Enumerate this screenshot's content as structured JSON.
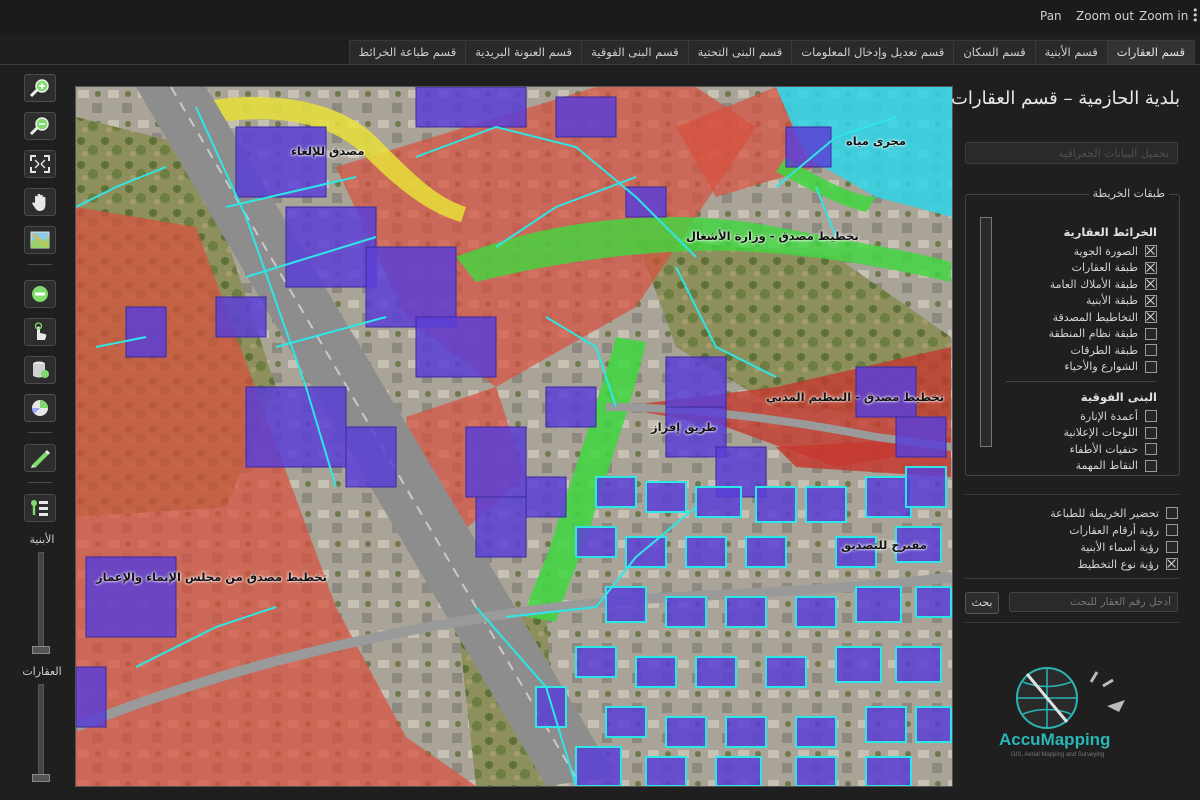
{
  "topbar": {
    "pan": "Pan",
    "zoom_out": "Zoom out",
    "zoom_in": "Zoom in"
  },
  "tabs": [
    "قسم العقارات",
    "قسم الأبنية",
    "قسم السكان",
    "قسم تعديل وإدخال المعلومات",
    "قسم البنى التحتية",
    "قسم البنى الفوقية",
    "قسم العنونة البريدية",
    "قسم طباعة الخرائط"
  ],
  "active_tab": 0,
  "toolbar": {
    "tools": [
      "zoom-in-icon",
      "zoom-out-icon",
      "full-extent-icon",
      "pan-hand-icon",
      "map-layer-icon",
      "minus-icon",
      "pointer-icon",
      "database-icon",
      "pie-chart-icon",
      "measure-icon",
      "legend-icon"
    ],
    "slider_buildings": {
      "label": "الأبنية",
      "level": 0.0
    },
    "slider_properties": {
      "label": "العقارات",
      "level": 0.0
    }
  },
  "map": {
    "labels": {
      "demolition": "مصدق للإلغاء",
      "water": "مجرى مياه",
      "works": "تخطيط مصدق - وزارة الأشغال",
      "urban": "تخطيط مصدق - التنظيم المدني",
      "road": "طريق إفراز",
      "reconstruction": "تخطيط مصدق من مجلس الإنماء والإعمار",
      "pending": "مقترح للتصديق"
    },
    "colors": {
      "zoning_red": "#d9503f",
      "buildings": "#5b3fd6",
      "parcels": "#2ee6e6",
      "approved_green": "#3fd83f",
      "demolition_yellow": "#e8e23a",
      "water": "#2fd5e8"
    }
  },
  "panel": {
    "title": "بلدية الحازمية – قسم العقارات",
    "load_button": "تحميل البيانات الجغرافية",
    "layers_legend": "طبقات الخريطة",
    "group1": {
      "title": "الخرائط العقارية",
      "items": [
        {
          "label": "الصورة الجوية",
          "checked": true
        },
        {
          "label": "طبقة العقارات",
          "checked": true
        },
        {
          "label": "طبقة الأملاك العامة",
          "checked": true
        },
        {
          "label": "طبقة الأبنية",
          "checked": true
        },
        {
          "label": "التخاطيط المصدقة",
          "checked": true
        },
        {
          "label": "طبقة نظام المنطقة",
          "checked": false
        },
        {
          "label": "طبقة الطرقات",
          "checked": false
        },
        {
          "label": "الشوارع والأحياء",
          "checked": false
        }
      ]
    },
    "group2": {
      "title": "البنى الفوقية",
      "items": [
        {
          "label": "أعمدة الإنارة",
          "checked": false
        },
        {
          "label": "اللوحات الإعلانية",
          "checked": false
        },
        {
          "label": "حنفيات الأطفاء",
          "checked": false
        },
        {
          "label": "النقاط المهمة",
          "checked": false
        }
      ]
    },
    "options": [
      {
        "label": "تحضير الخريطة للطباعة",
        "checked": false
      },
      {
        "label": "رؤية أرقام العقارات",
        "checked": false
      },
      {
        "label": "رؤية أسماء الأبنية",
        "checked": false
      },
      {
        "label": "رؤية نوع التخطيط",
        "checked": true
      }
    ],
    "search_button": "بحث",
    "search_placeholder": "أدخل رقم العقار للبحث"
  },
  "logo": {
    "name": "AccuMapping",
    "tagline": "GIS, Aerial Mapping and Surveying"
  }
}
